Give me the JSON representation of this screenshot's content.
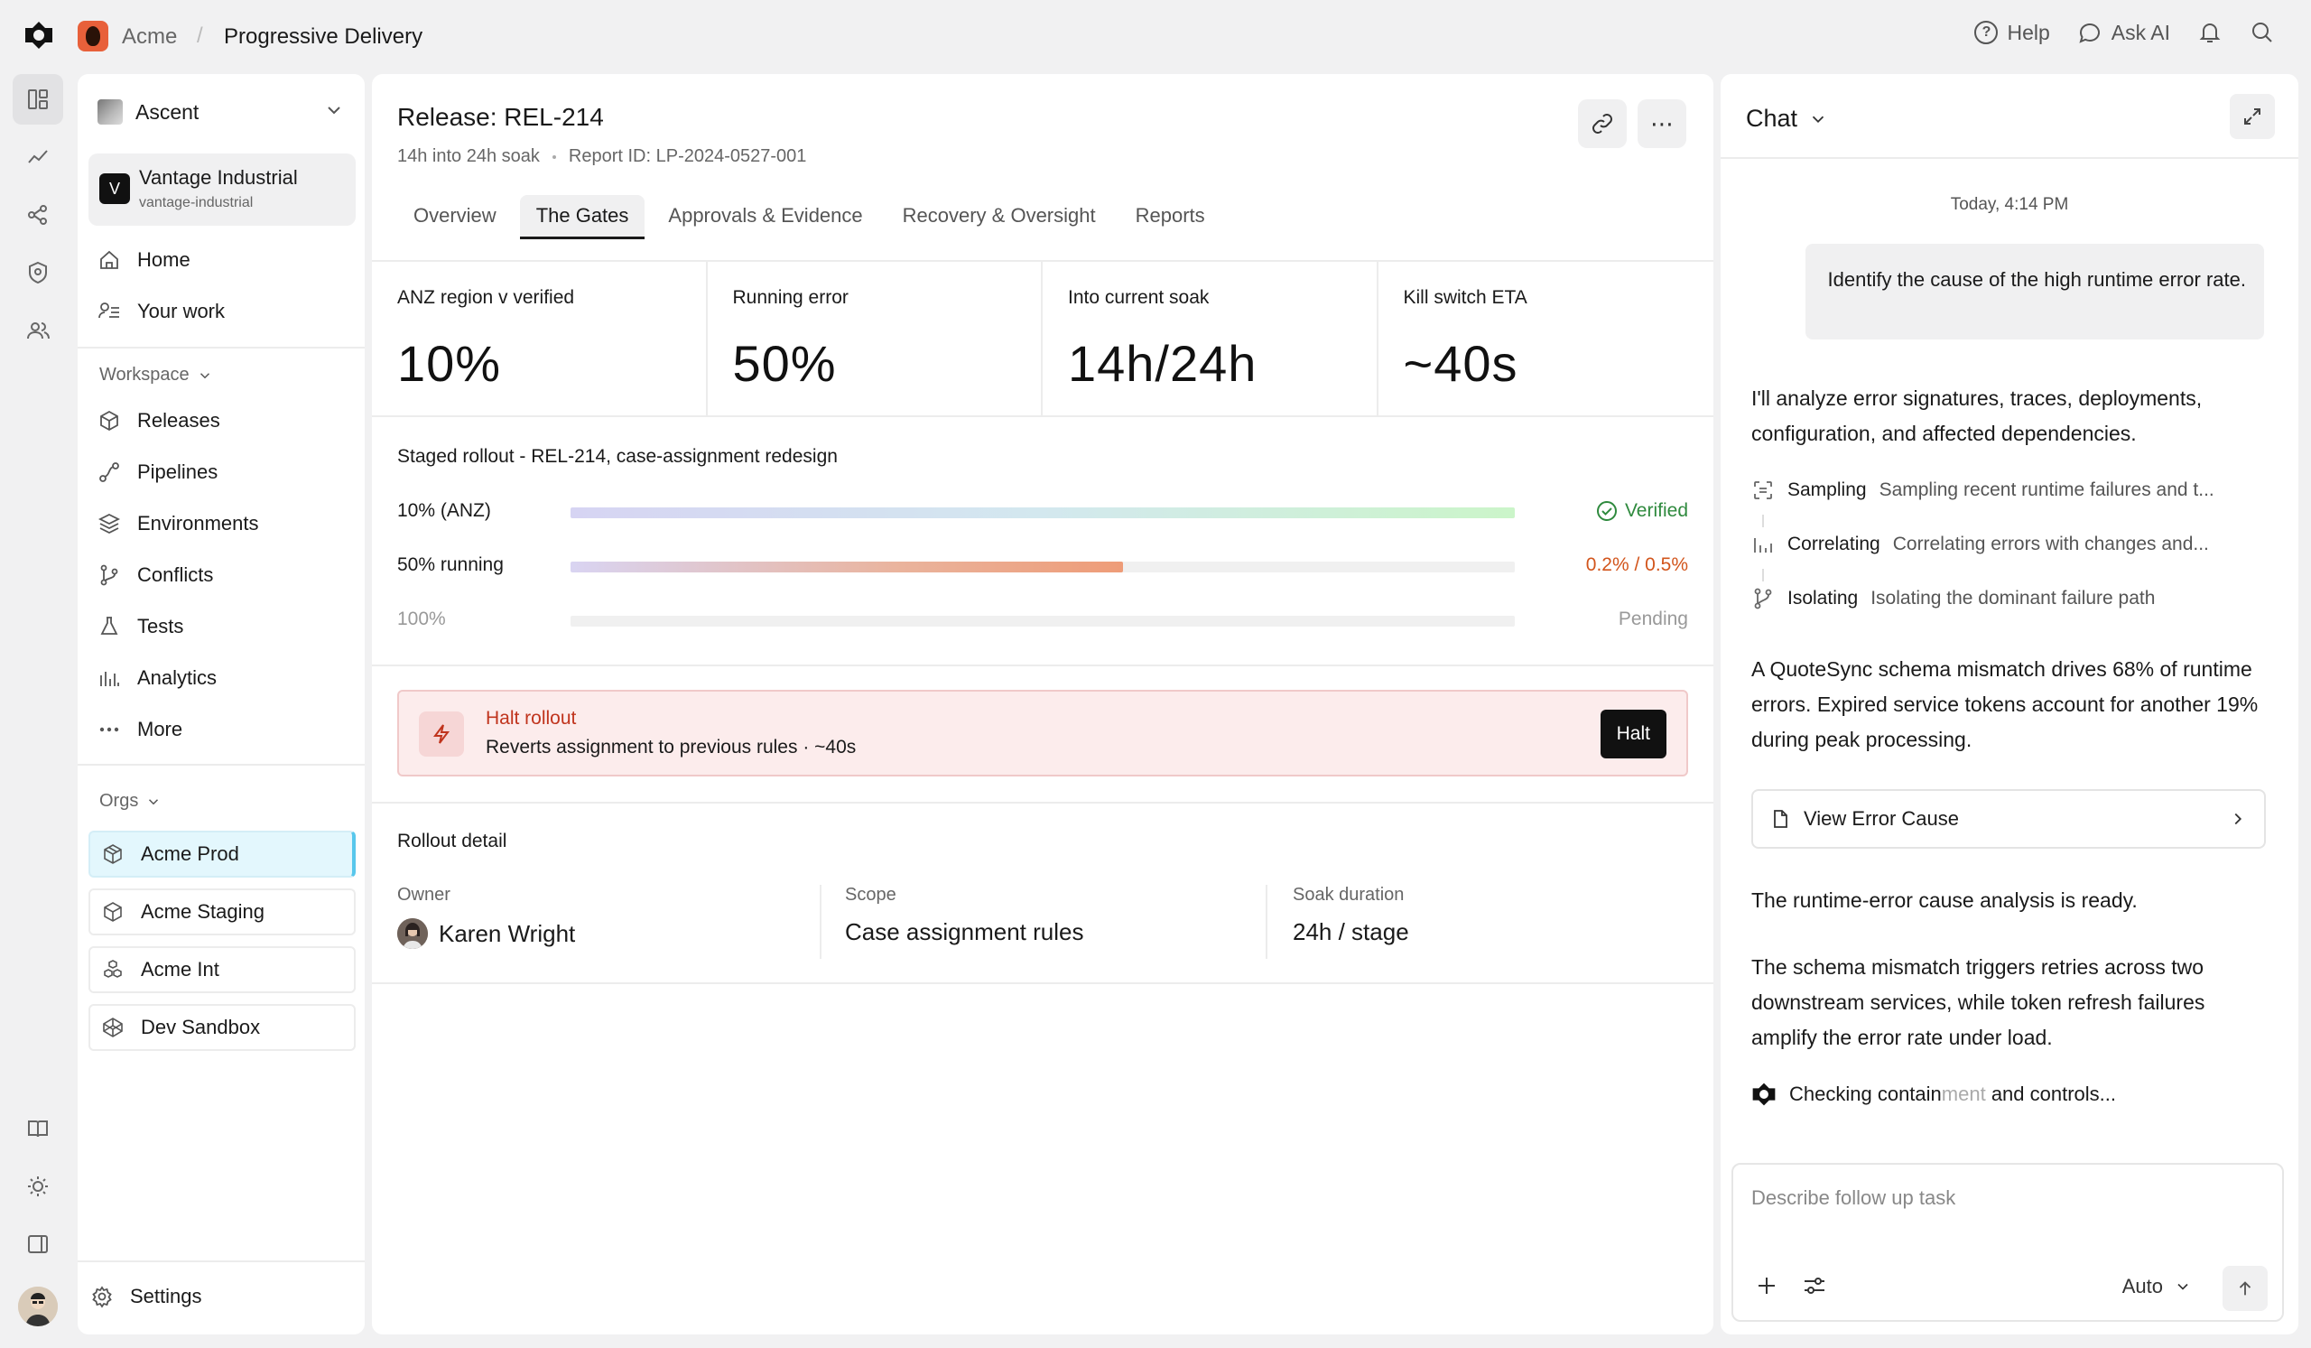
{
  "breadcrumb": {
    "org": "Acme",
    "separator": "/",
    "page": "Progressive Delivery"
  },
  "top_actions": {
    "help": "Help",
    "ask_ai": "Ask AI"
  },
  "sidebar": {
    "workspace_select": "Ascent",
    "org_card": {
      "badge": "V",
      "name": "Vantage Industrial",
      "slug": "vantage-industrial"
    },
    "primary_nav": [
      {
        "label": "Home",
        "icon": "home-icon"
      },
      {
        "label": "Your work",
        "icon": "user-list-icon"
      }
    ],
    "workspace_label": "Workspace",
    "workspace_nav": [
      {
        "label": "Releases",
        "icon": "box-icon"
      },
      {
        "label": "Pipelines",
        "icon": "pipeline-icon"
      },
      {
        "label": "Environments",
        "icon": "layers-icon"
      },
      {
        "label": "Conflicts",
        "icon": "branch-icon"
      },
      {
        "label": "Tests",
        "icon": "flask-icon"
      },
      {
        "label": "Analytics",
        "icon": "bar-chart-icon"
      },
      {
        "label": "More",
        "icon": "dots-icon"
      }
    ],
    "orgs_label": "Orgs",
    "orgs": [
      {
        "label": "Acme Prod",
        "active": true
      },
      {
        "label": "Acme Staging",
        "active": false
      },
      {
        "label": "Acme Int",
        "active": false
      },
      {
        "label": "Dev Sandbox",
        "active": false
      }
    ],
    "settings": "Settings"
  },
  "release": {
    "title": "Release: REL-214",
    "soak": "14h into 24h soak",
    "report_id": "Report ID: LP-2024-0527-001",
    "tabs": [
      {
        "label": "Overview",
        "active": false
      },
      {
        "label": "The Gates",
        "active": true
      },
      {
        "label": "Approvals & Evidence",
        "active": false
      },
      {
        "label": "Recovery & Oversight",
        "active": false
      },
      {
        "label": "Reports",
        "active": false
      }
    ],
    "stats": [
      {
        "label": "ANZ region v verified",
        "value": "10%"
      },
      {
        "label": "Running error",
        "value": "50%"
      },
      {
        "label": "Into current soak",
        "value": "14h/24h"
      },
      {
        "label": "Kill switch ETA",
        "value": "~40s"
      }
    ],
    "rollout": {
      "title": "Staged rollout - REL-214, case-assignment redesign",
      "stages": [
        {
          "label": "10% (ANZ)",
          "status": "Verified",
          "progress": 1.0,
          "state": "verified"
        },
        {
          "label": "50% running",
          "status": "0.2% / 0.5%",
          "progress": 0.585,
          "state": "running"
        },
        {
          "label": "100%",
          "status": "Pending",
          "progress": 0,
          "state": "pending"
        }
      ]
    },
    "halt": {
      "title": "Halt rollout",
      "description": "Reverts assignment to previous rules · ~40s",
      "button": "Halt"
    },
    "detail": {
      "title": "Rollout detail",
      "owner_label": "Owner",
      "owner": "Karen Wright",
      "scope_label": "Scope",
      "scope": "Case assignment rules",
      "soak_label": "Soak duration",
      "soak": "24h / stage"
    }
  },
  "chat": {
    "title": "Chat",
    "timestamp": "Today, 4:14 PM",
    "user_message": "Identify the cause of the high runtime error rate.",
    "intro": "I'll analyze error signatures, traces, deployments, configuration, and affected dependencies.",
    "steps": [
      {
        "name": "Sampling",
        "desc": "Sampling recent runtime failures and t..."
      },
      {
        "name": "Correlating",
        "desc": "Correlating errors with changes and..."
      },
      {
        "name": "Isolating",
        "desc": "Isolating the dominant failure path"
      }
    ],
    "finding": "A QuoteSync schema mismatch drives 68% of runtime errors. Expired service tokens account for another 19% during peak processing.",
    "view_card": "View Error Cause",
    "ready": "The runtime-error cause analysis is ready.",
    "explanation": "The schema mismatch triggers retries across two downstream services, while token refresh failures amplify the error rate under load.",
    "thinking_a": "Checking contain",
    "thinking_b": "ment",
    "thinking_c": " and controls...",
    "composer_placeholder": "Describe follow up task",
    "model": "Auto"
  },
  "colors": {
    "verified": "#2f8a3e",
    "running": "#d2551c",
    "halt": "#c0341d",
    "org_active": "#58c7ec"
  }
}
